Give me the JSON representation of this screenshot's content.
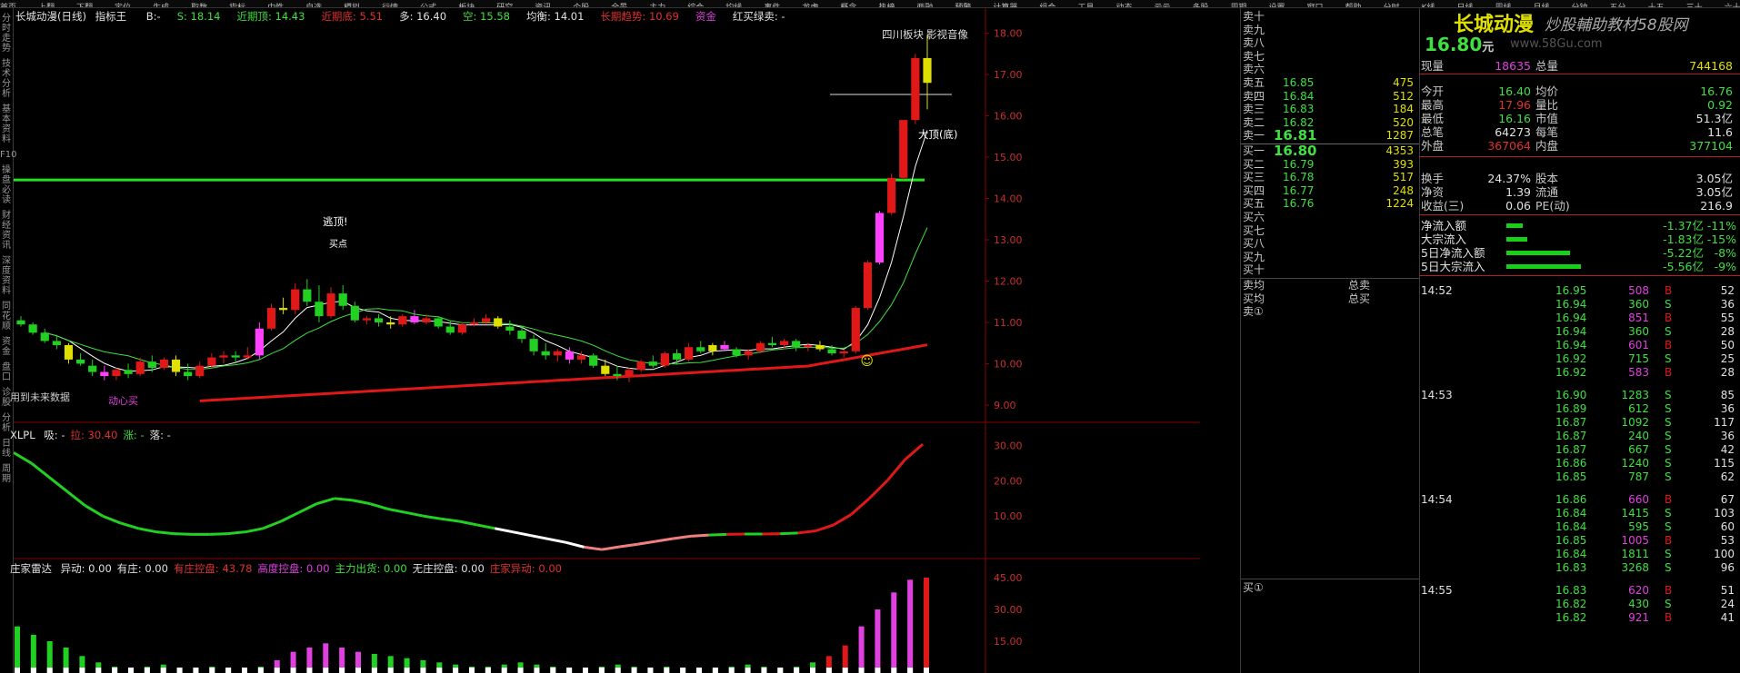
{
  "menubar": {
    "items": [
      "首页",
      "上翻",
      "下翻",
      "定位",
      "生成",
      "取数",
      "指标",
      "中性",
      "自选",
      "模拟",
      "行情",
      "公式",
      "板块",
      "研究",
      "资讯",
      "个股",
      "全景",
      "主力",
      "综合",
      "均线",
      "事件",
      "龙虎",
      "概念",
      "热榜",
      "两融",
      "预警",
      "计算器",
      "组合",
      "工具",
      "动态",
      "云云",
      "多股",
      "周期",
      "设置",
      "窗口",
      "帮助",
      "分时",
      "K线",
      "日线",
      "周线",
      "月线",
      "分钟",
      "五分",
      "十五",
      "三十",
      "六十",
      "季线",
      "年线"
    ]
  },
  "left_tabs": [
    "分时走势",
    "技术分析",
    "基本资料",
    "F10",
    "操盘必读",
    "财经资讯",
    "深度资料",
    "同花顺",
    "资金",
    "盘口",
    "诊股",
    "分析",
    "日线",
    "周期"
  ],
  "chart": {
    "title": "长城动漫(日线)",
    "indicator": "指标王",
    "tags": [
      {
        "text": "B:-",
        "color": "#e0e0e0"
      },
      {
        "text": "S: 18.14",
        "color": "#3fe03f"
      },
      {
        "text": "近期顶: 14.43",
        "color": "#3fe03f"
      },
      {
        "text": "近期底: 5.51",
        "color": "#e03030"
      },
      {
        "text": "多: 16.40",
        "color": "#e0e0e0"
      },
      {
        "text": "空: 15.58",
        "color": "#3fe03f"
      },
      {
        "text": "均衡: 14.01",
        "color": "#e0e0e0"
      },
      {
        "text": "长期趋势: 10.69",
        "color": "#e03030"
      },
      {
        "text": "资金",
        "color": "#e040e0"
      },
      {
        "text": "红买绿卖: -",
        "color": "#e0e0e0"
      }
    ],
    "annotations": {
      "tiantop": "逃顶!",
      "buy_label": "买点",
      "top_label": "大顶(底)",
      "board": "四川板块",
      "view": "影视音像",
      "future_note": "用到未来数据",
      "heart_buy": "动心买"
    },
    "price_axis": [
      "18.00",
      "17.00",
      "16.00",
      "15.00",
      "14.00",
      "13.00",
      "12.00",
      "11.00",
      "10.00",
      "9.00"
    ],
    "xlpl_header": {
      "name": "XLPL",
      "items": [
        {
          "text": "吸: -",
          "color": "#e0e0e0"
        },
        {
          "text": "拉: 30.40",
          "color": "#e03030"
        },
        {
          "text": "涨: -",
          "color": "#3fe03f"
        },
        {
          "text": "落: -",
          "color": "#e0e0e0"
        }
      ]
    },
    "xlpl_axis": [
      "30.00",
      "20.00",
      "10.00"
    ],
    "radar_header": {
      "name": "庄家雷达",
      "items": [
        {
          "text": "异动: 0.00",
          "color": "#e0e0e0"
        },
        {
          "text": "有庄: 0.00",
          "color": "#e0e0e0"
        },
        {
          "text": "有庄控盘: 43.78",
          "color": "#e03030"
        },
        {
          "text": "高度控盘: 0.00",
          "color": "#e040e0"
        },
        {
          "text": "主力出货: 0.00",
          "color": "#3fe03f"
        },
        {
          "text": "无庄控盘: 0.00",
          "color": "#e0e0e0"
        },
        {
          "text": "庄家异动: 0.00",
          "color": "#e03030"
        }
      ]
    },
    "radar_axis": [
      "45.00",
      "30.00",
      "15.00"
    ]
  },
  "chart_data": {
    "type": "candlestick",
    "candles": [
      [
        11.05,
        11.15,
        10.9,
        10.95
      ],
      [
        10.95,
        11.0,
        10.7,
        10.75
      ],
      [
        10.75,
        10.85,
        10.5,
        10.55
      ],
      [
        10.55,
        10.7,
        10.35,
        10.45
      ],
      [
        10.45,
        10.5,
        10.0,
        10.1
      ],
      [
        10.1,
        10.25,
        9.95,
        10.0
      ],
      [
        9.95,
        10.1,
        9.7,
        9.8
      ],
      [
        9.8,
        9.95,
        9.6,
        9.7
      ],
      [
        9.7,
        9.9,
        9.6,
        9.85
      ],
      [
        9.85,
        10.0,
        9.65,
        9.75
      ],
      [
        9.75,
        10.15,
        9.7,
        10.05
      ],
      [
        10.05,
        10.2,
        9.8,
        9.9
      ],
      [
        9.9,
        10.15,
        9.85,
        10.1
      ],
      [
        10.1,
        10.2,
        9.7,
        9.8
      ],
      [
        9.8,
        10.0,
        9.6,
        9.7
      ],
      [
        9.7,
        10.05,
        9.65,
        9.95
      ],
      [
        9.95,
        10.25,
        9.9,
        10.15
      ],
      [
        10.15,
        10.3,
        10.0,
        10.2
      ],
      [
        10.2,
        10.3,
        10.05,
        10.15
      ],
      [
        10.15,
        10.4,
        10.1,
        10.2
      ],
      [
        10.2,
        11.0,
        10.1,
        10.85
      ],
      [
        10.85,
        11.45,
        10.8,
        11.35
      ],
      [
        11.35,
        11.6,
        11.2,
        11.3
      ],
      [
        11.3,
        11.95,
        11.2,
        11.8
      ],
      [
        11.8,
        12.05,
        11.4,
        11.5
      ],
      [
        11.5,
        11.9,
        11.0,
        11.15
      ],
      [
        11.15,
        11.85,
        11.1,
        11.7
      ],
      [
        11.7,
        11.9,
        11.3,
        11.4
      ],
      [
        11.4,
        11.5,
        11.0,
        11.05
      ],
      [
        11.05,
        11.15,
        10.95,
        11.1
      ],
      [
        11.1,
        11.2,
        10.9,
        11.0
      ],
      [
        11.0,
        11.15,
        10.85,
        10.95
      ],
      [
        10.95,
        11.2,
        10.9,
        11.15
      ],
      [
        11.15,
        11.3,
        10.95,
        11.0
      ],
      [
        11.0,
        11.2,
        10.95,
        11.1
      ],
      [
        11.1,
        11.15,
        10.85,
        10.9
      ],
      [
        10.9,
        11.05,
        10.7,
        10.75
      ],
      [
        10.75,
        11.0,
        10.7,
        10.95
      ],
      [
        10.95,
        11.1,
        10.9,
        11.0
      ],
      [
        11.0,
        11.2,
        10.95,
        11.1
      ],
      [
        11.1,
        11.15,
        10.85,
        10.9
      ],
      [
        10.9,
        11.05,
        10.7,
        10.8
      ],
      [
        10.8,
        10.9,
        10.5,
        10.6
      ],
      [
        10.6,
        10.7,
        10.2,
        10.3
      ],
      [
        10.3,
        10.5,
        10.1,
        10.2
      ],
      [
        10.2,
        10.35,
        10.05,
        10.3
      ],
      [
        10.3,
        10.4,
        10.0,
        10.1
      ],
      [
        10.1,
        10.3,
        10.0,
        10.2
      ],
      [
        10.2,
        10.25,
        9.9,
        9.95
      ],
      [
        9.95,
        10.1,
        9.7,
        9.75
      ],
      [
        9.75,
        9.95,
        9.6,
        9.7
      ],
      [
        9.7,
        9.9,
        9.55,
        9.85
      ],
      [
        9.85,
        10.1,
        9.8,
        10.05
      ],
      [
        10.05,
        10.2,
        9.9,
        9.95
      ],
      [
        9.95,
        10.3,
        9.9,
        10.25
      ],
      [
        10.25,
        10.35,
        10.0,
        10.1
      ],
      [
        10.1,
        10.5,
        10.05,
        10.4
      ],
      [
        10.4,
        10.55,
        10.25,
        10.3
      ],
      [
        10.3,
        10.5,
        10.2,
        10.45
      ],
      [
        10.45,
        10.55,
        10.3,
        10.35
      ],
      [
        10.35,
        10.4,
        10.15,
        10.2
      ],
      [
        10.2,
        10.35,
        10.1,
        10.3
      ],
      [
        10.3,
        10.55,
        10.25,
        10.5
      ],
      [
        10.5,
        10.65,
        10.4,
        10.45
      ],
      [
        10.45,
        10.6,
        10.35,
        10.55
      ],
      [
        10.55,
        10.6,
        10.3,
        10.4
      ],
      [
        10.4,
        10.5,
        10.3,
        10.45
      ],
      [
        10.45,
        10.55,
        10.3,
        10.35
      ],
      [
        10.35,
        10.45,
        10.2,
        10.25
      ],
      [
        10.25,
        10.35,
        10.15,
        10.3
      ],
      [
        10.3,
        11.4,
        10.25,
        11.35
      ],
      [
        11.35,
        12.5,
        11.3,
        12.45
      ],
      [
        12.45,
        13.7,
        12.4,
        13.65
      ],
      [
        13.65,
        14.6,
        13.6,
        14.5
      ],
      [
        14.5,
        15.9,
        14.45,
        15.9
      ],
      [
        15.9,
        17.5,
        15.8,
        17.4
      ],
      [
        17.4,
        17.96,
        16.16,
        16.8
      ]
    ],
    "ylim": [
      8.8,
      18.3
    ]
  },
  "orderbook": {
    "sell_labels": [
      "卖十",
      "卖九",
      "卖八",
      "卖七",
      "卖六",
      "卖五",
      "卖四",
      "卖三",
      "卖二",
      "卖一"
    ],
    "sell": [
      {
        "px": "",
        "vol": ""
      },
      {
        "px": "",
        "vol": ""
      },
      {
        "px": "",
        "vol": ""
      },
      {
        "px": "",
        "vol": ""
      },
      {
        "px": "",
        "vol": ""
      },
      {
        "px": "16.85",
        "vol": "475"
      },
      {
        "px": "16.84",
        "vol": "512"
      },
      {
        "px": "16.83",
        "vol": "184"
      },
      {
        "px": "16.82",
        "vol": "520"
      },
      {
        "px": "16.81",
        "vol": "1287"
      }
    ],
    "buy_labels": [
      "买一",
      "买二",
      "买三",
      "买四",
      "买五",
      "买六",
      "买七",
      "买八",
      "买九",
      "买十"
    ],
    "buy": [
      {
        "px": "16.80",
        "vol": "4353"
      },
      {
        "px": "16.79",
        "vol": "393"
      },
      {
        "px": "16.78",
        "vol": "517"
      },
      {
        "px": "16.77",
        "vol": "248"
      },
      {
        "px": "16.76",
        "vol": "1224"
      },
      {
        "px": "",
        "vol": ""
      },
      {
        "px": "",
        "vol": ""
      },
      {
        "px": "",
        "vol": ""
      },
      {
        "px": "",
        "vol": ""
      },
      {
        "px": "",
        "vol": ""
      }
    ],
    "avg_sell_label": "卖均",
    "avg_buy_label": "买均",
    "total_sell_label": "总卖",
    "total_buy_label": "总买",
    "sell_queue_label": "卖①",
    "buy_queue_label": "买①"
  },
  "quote": {
    "name": "长城动漫",
    "watermark": "炒股輔助教材58股网",
    "watermark_url": "www.58Gu.com",
    "price": "16.80",
    "unit": "元",
    "rows": [
      {
        "l": "现量",
        "v": "18635",
        "vc": "#e040e0",
        "l2": "总量",
        "v2": "744168",
        "v2c": "#e0e000"
      },
      {
        "l": "今开",
        "v": "16.40",
        "vc": "#3fe03f",
        "l2": "均价",
        "v2": "16.76",
        "v2c": "#3fe03f"
      },
      {
        "l": "最高",
        "v": "17.96",
        "vc": "#e03030",
        "l2": "量比",
        "v2": "0.92",
        "v2c": "#3fe03f"
      },
      {
        "l": "最低",
        "v": "16.16",
        "vc": "#3fe03f",
        "l2": "市值",
        "v2": "51.3亿",
        "v2c": "#e0e0e0"
      },
      {
        "l": "总笔",
        "v": "64273",
        "vc": "#e0e0e0",
        "l2": "每笔",
        "v2": "11.6",
        "v2c": "#e0e0e0"
      },
      {
        "l": "外盘",
        "v": "367064",
        "vc": "#e03030",
        "l2": "内盘",
        "v2": "377104",
        "v2c": "#3fe03f"
      },
      {
        "l": "换手",
        "v": "24.37%",
        "vc": "#e0e0e0",
        "l2": "股本",
        "v2": "3.05亿",
        "v2c": "#e0e0e0"
      },
      {
        "l": "净资",
        "v": "1.39",
        "vc": "#e0e0e0",
        "l2": "流通",
        "v2": "3.05亿",
        "v2c": "#e0e0e0"
      },
      {
        "l": "收益(三)",
        "v": "0.06",
        "vc": "#e0e0e0",
        "l2": "PE(动)",
        "v2": "216.9",
        "v2c": "#e0e0e0"
      }
    ],
    "flows": [
      {
        "l": "净流入额",
        "v": "-1.37亿",
        "p": "-11%",
        "w": 0.22
      },
      {
        "l": "大宗流入",
        "v": "-1.83亿",
        "p": "-15%",
        "w": 0.28
      },
      {
        "l": "5日净流入额",
        "v": "-5.22亿",
        "p": "-8%",
        "w": 0.85
      },
      {
        "l": "5日大宗流入",
        "v": "-5.56亿",
        "p": "-9%",
        "w": 1.0
      }
    ],
    "trades": [
      {
        "t": "14:52",
        "px": "16.95",
        "vol": "508",
        "bs": "B",
        "n": "52"
      },
      {
        "t": "",
        "px": "16.94",
        "vol": "360",
        "bs": "S",
        "n": "36"
      },
      {
        "t": "",
        "px": "16.94",
        "vol": "851",
        "bs": "B",
        "n": "55"
      },
      {
        "t": "",
        "px": "16.94",
        "vol": "360",
        "bs": "S",
        "n": "28"
      },
      {
        "t": "",
        "px": "16.94",
        "vol": "601",
        "bs": "B",
        "n": "50"
      },
      {
        "t": "",
        "px": "16.92",
        "vol": "715",
        "bs": "S",
        "n": "25"
      },
      {
        "t": "",
        "px": "16.92",
        "vol": "583",
        "bs": "B",
        "n": "28"
      },
      {
        "t": "14:53",
        "px": "16.90",
        "vol": "1283",
        "bs": "S",
        "n": "85"
      },
      {
        "t": "",
        "px": "16.89",
        "vol": "612",
        "bs": "S",
        "n": "36"
      },
      {
        "t": "",
        "px": "16.87",
        "vol": "1092",
        "bs": "S",
        "n": "117"
      },
      {
        "t": "",
        "px": "16.87",
        "vol": "240",
        "bs": "S",
        "n": "36"
      },
      {
        "t": "",
        "px": "16.87",
        "vol": "667",
        "bs": "S",
        "n": "42"
      },
      {
        "t": "",
        "px": "16.86",
        "vol": "1240",
        "bs": "S",
        "n": "115"
      },
      {
        "t": "",
        "px": "16.85",
        "vol": "787",
        "bs": "S",
        "n": "62"
      },
      {
        "t": "14:54",
        "px": "16.86",
        "vol": "660",
        "bs": "B",
        "n": "67"
      },
      {
        "t": "",
        "px": "16.84",
        "vol": "1415",
        "bs": "S",
        "n": "103"
      },
      {
        "t": "",
        "px": "16.84",
        "vol": "595",
        "bs": "S",
        "n": "60"
      },
      {
        "t": "",
        "px": "16.85",
        "vol": "1005",
        "bs": "B",
        "n": "53"
      },
      {
        "t": "",
        "px": "16.84",
        "vol": "1811",
        "bs": "S",
        "n": "100"
      },
      {
        "t": "",
        "px": "16.83",
        "vol": "3268",
        "bs": "S",
        "n": "96"
      },
      {
        "t": "14:55",
        "px": "16.83",
        "vol": "620",
        "bs": "B",
        "n": "51"
      },
      {
        "t": "",
        "px": "16.82",
        "vol": "430",
        "bs": "S",
        "n": "24"
      },
      {
        "t": "",
        "px": "16.82",
        "vol": "921",
        "bs": "B",
        "n": "41"
      }
    ]
  }
}
